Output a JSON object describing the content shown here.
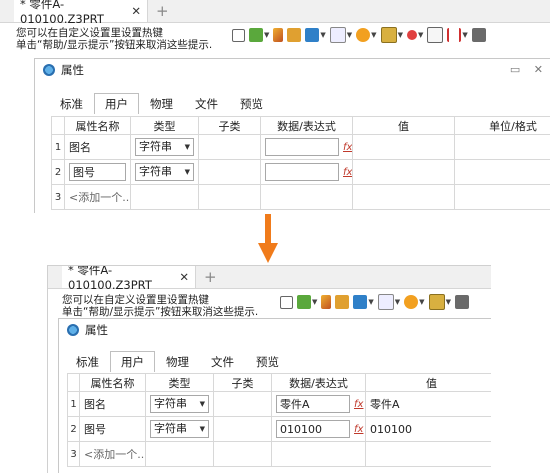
{
  "document_tab": {
    "title": "* 零件A-010100.Z3PRT",
    "close": "✕",
    "add": "+"
  },
  "hint": {
    "line1": "您可以在自定义设置里设置热键",
    "line2": "单击“帮助/显示提示”按钮来取消这些提示."
  },
  "toolbar_icons": [
    "import-icon",
    "sketch-icon",
    "pen-icon",
    "shape-icon",
    "solid-icon",
    "wire-icon",
    "render-icon",
    "view-icon",
    "snap-icon",
    "grid-icon",
    "dimension-icon",
    "display-icon"
  ],
  "dialog": {
    "title": "属性",
    "pin": "▭",
    "close": "✕"
  },
  "prop_tabs": [
    {
      "label": "标准",
      "active": false
    },
    {
      "label": "用户",
      "active": true
    },
    {
      "label": "物理",
      "active": false
    },
    {
      "label": "文件",
      "active": false
    },
    {
      "label": "预览",
      "active": false
    }
  ],
  "columns": [
    "属性名称",
    "类型",
    "子类",
    "数据/表达式",
    "值",
    "单位/格式"
  ],
  "before": {
    "rows": [
      {
        "num": "1",
        "name": "图名",
        "type": "字符串",
        "expr": "",
        "value": ""
      },
      {
        "num": "2",
        "name": "图号",
        "type": "字符串",
        "expr": "",
        "value": ""
      }
    ],
    "add_row": {
      "num": "3",
      "label": "<添加一个..."
    }
  },
  "after": {
    "rows": [
      {
        "num": "1",
        "name": "图名",
        "type": "字符串",
        "expr": "零件A",
        "value": "零件A"
      },
      {
        "num": "2",
        "name": "图号",
        "type": "字符串",
        "expr": "010100",
        "value": "010100"
      }
    ],
    "add_row": {
      "num": "3",
      "label": "<添加一个..."
    }
  },
  "colors": {
    "arrow": "#f07b1b",
    "fx": "#c0392b"
  }
}
